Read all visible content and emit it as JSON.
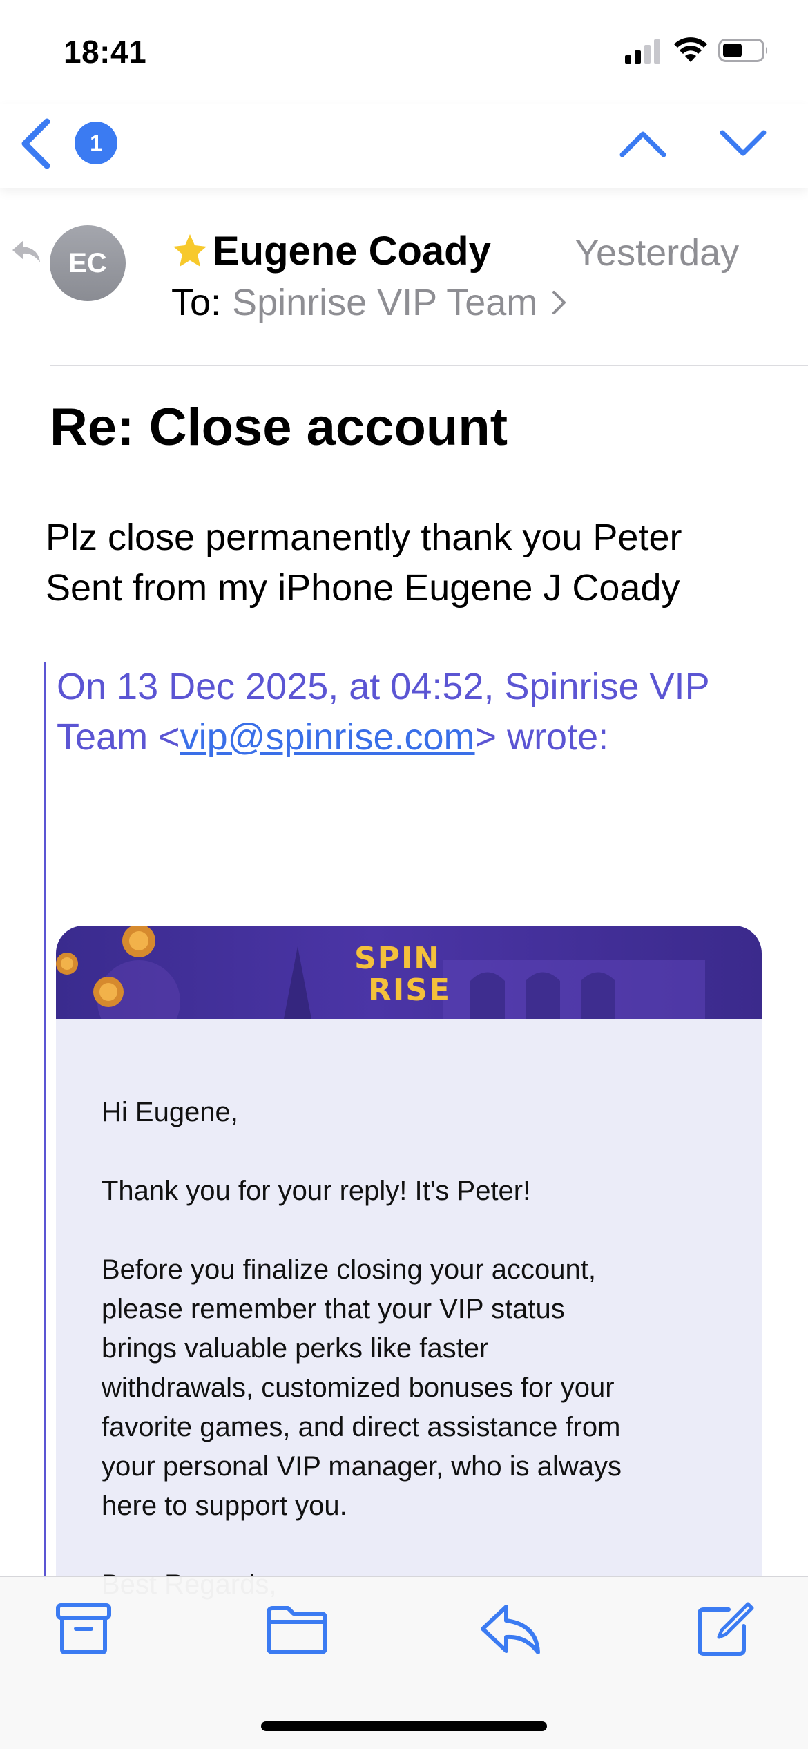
{
  "status_bar": {
    "time": "18:41"
  },
  "nav": {
    "unread_count": "1"
  },
  "message": {
    "avatar_initials": "EC",
    "sender": "Eugene Coady",
    "date": "Yesterday",
    "to_label": "To:",
    "recipient": "Spinrise VIP Team",
    "subject": "Re: Close account",
    "body_line1": "Plz close permanently thank you Peter",
    "body_line2": "Sent from my iPhone Eugene J Coady"
  },
  "quote": {
    "header_prefix": "On 13 Dec 2025, at 04:52, Spinrise VIP Team <",
    "email": "vip@spinrise.com",
    "header_suffix": "> wrote:",
    "brand_line1": "SPIN",
    "brand_line2": "RISE",
    "greeting": "Hi Eugene,",
    "para1": "Thank you for your reply! It's Peter!",
    "para2_lines": [
      "Before you finalize closing your account,",
      "please remember that your VIP status",
      "brings valuable perks like faster",
      "withdrawals, customized bonuses for your",
      "favorite games, and direct assistance from",
      "your personal VIP manager, who is always",
      "here to support you."
    ],
    "signoff": "Best Regards,"
  },
  "colors": {
    "accent": "#3b7bf2",
    "quote": "#5b55d3",
    "star": "#f7c92c"
  }
}
